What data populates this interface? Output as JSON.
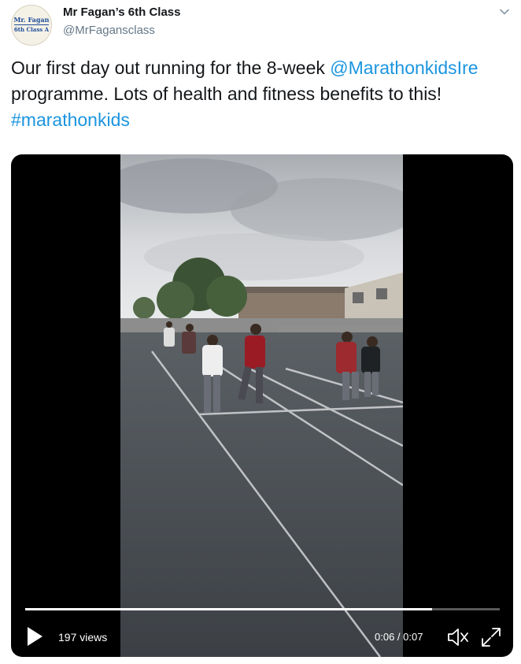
{
  "author": {
    "name": "Mr Fagan’s 6th Class",
    "handle": "@MrFagansclass",
    "avatar_line1": "Mr. Fagan",
    "avatar_line2": "6th Class A"
  },
  "tweet": {
    "text_part1": "Our first day out running for the 8-week ",
    "mention": "@MarathonkidsIre",
    "text_part2": " programme. Lots of health and fitness benefits to this! ",
    "hashtag": "#marathonkids"
  },
  "video": {
    "views": "197 views",
    "time": "0:06 / 0:07",
    "progress": 0.857
  },
  "icons": {
    "caret": "chevron-down-icon",
    "play": "play-icon",
    "mute": "volume-muted-icon",
    "fullscreen": "fullscreen-expand-icon"
  },
  "colors": {
    "link": "#1b95e0",
    "secondary_text": "#657786",
    "video_bg": "#000000"
  }
}
